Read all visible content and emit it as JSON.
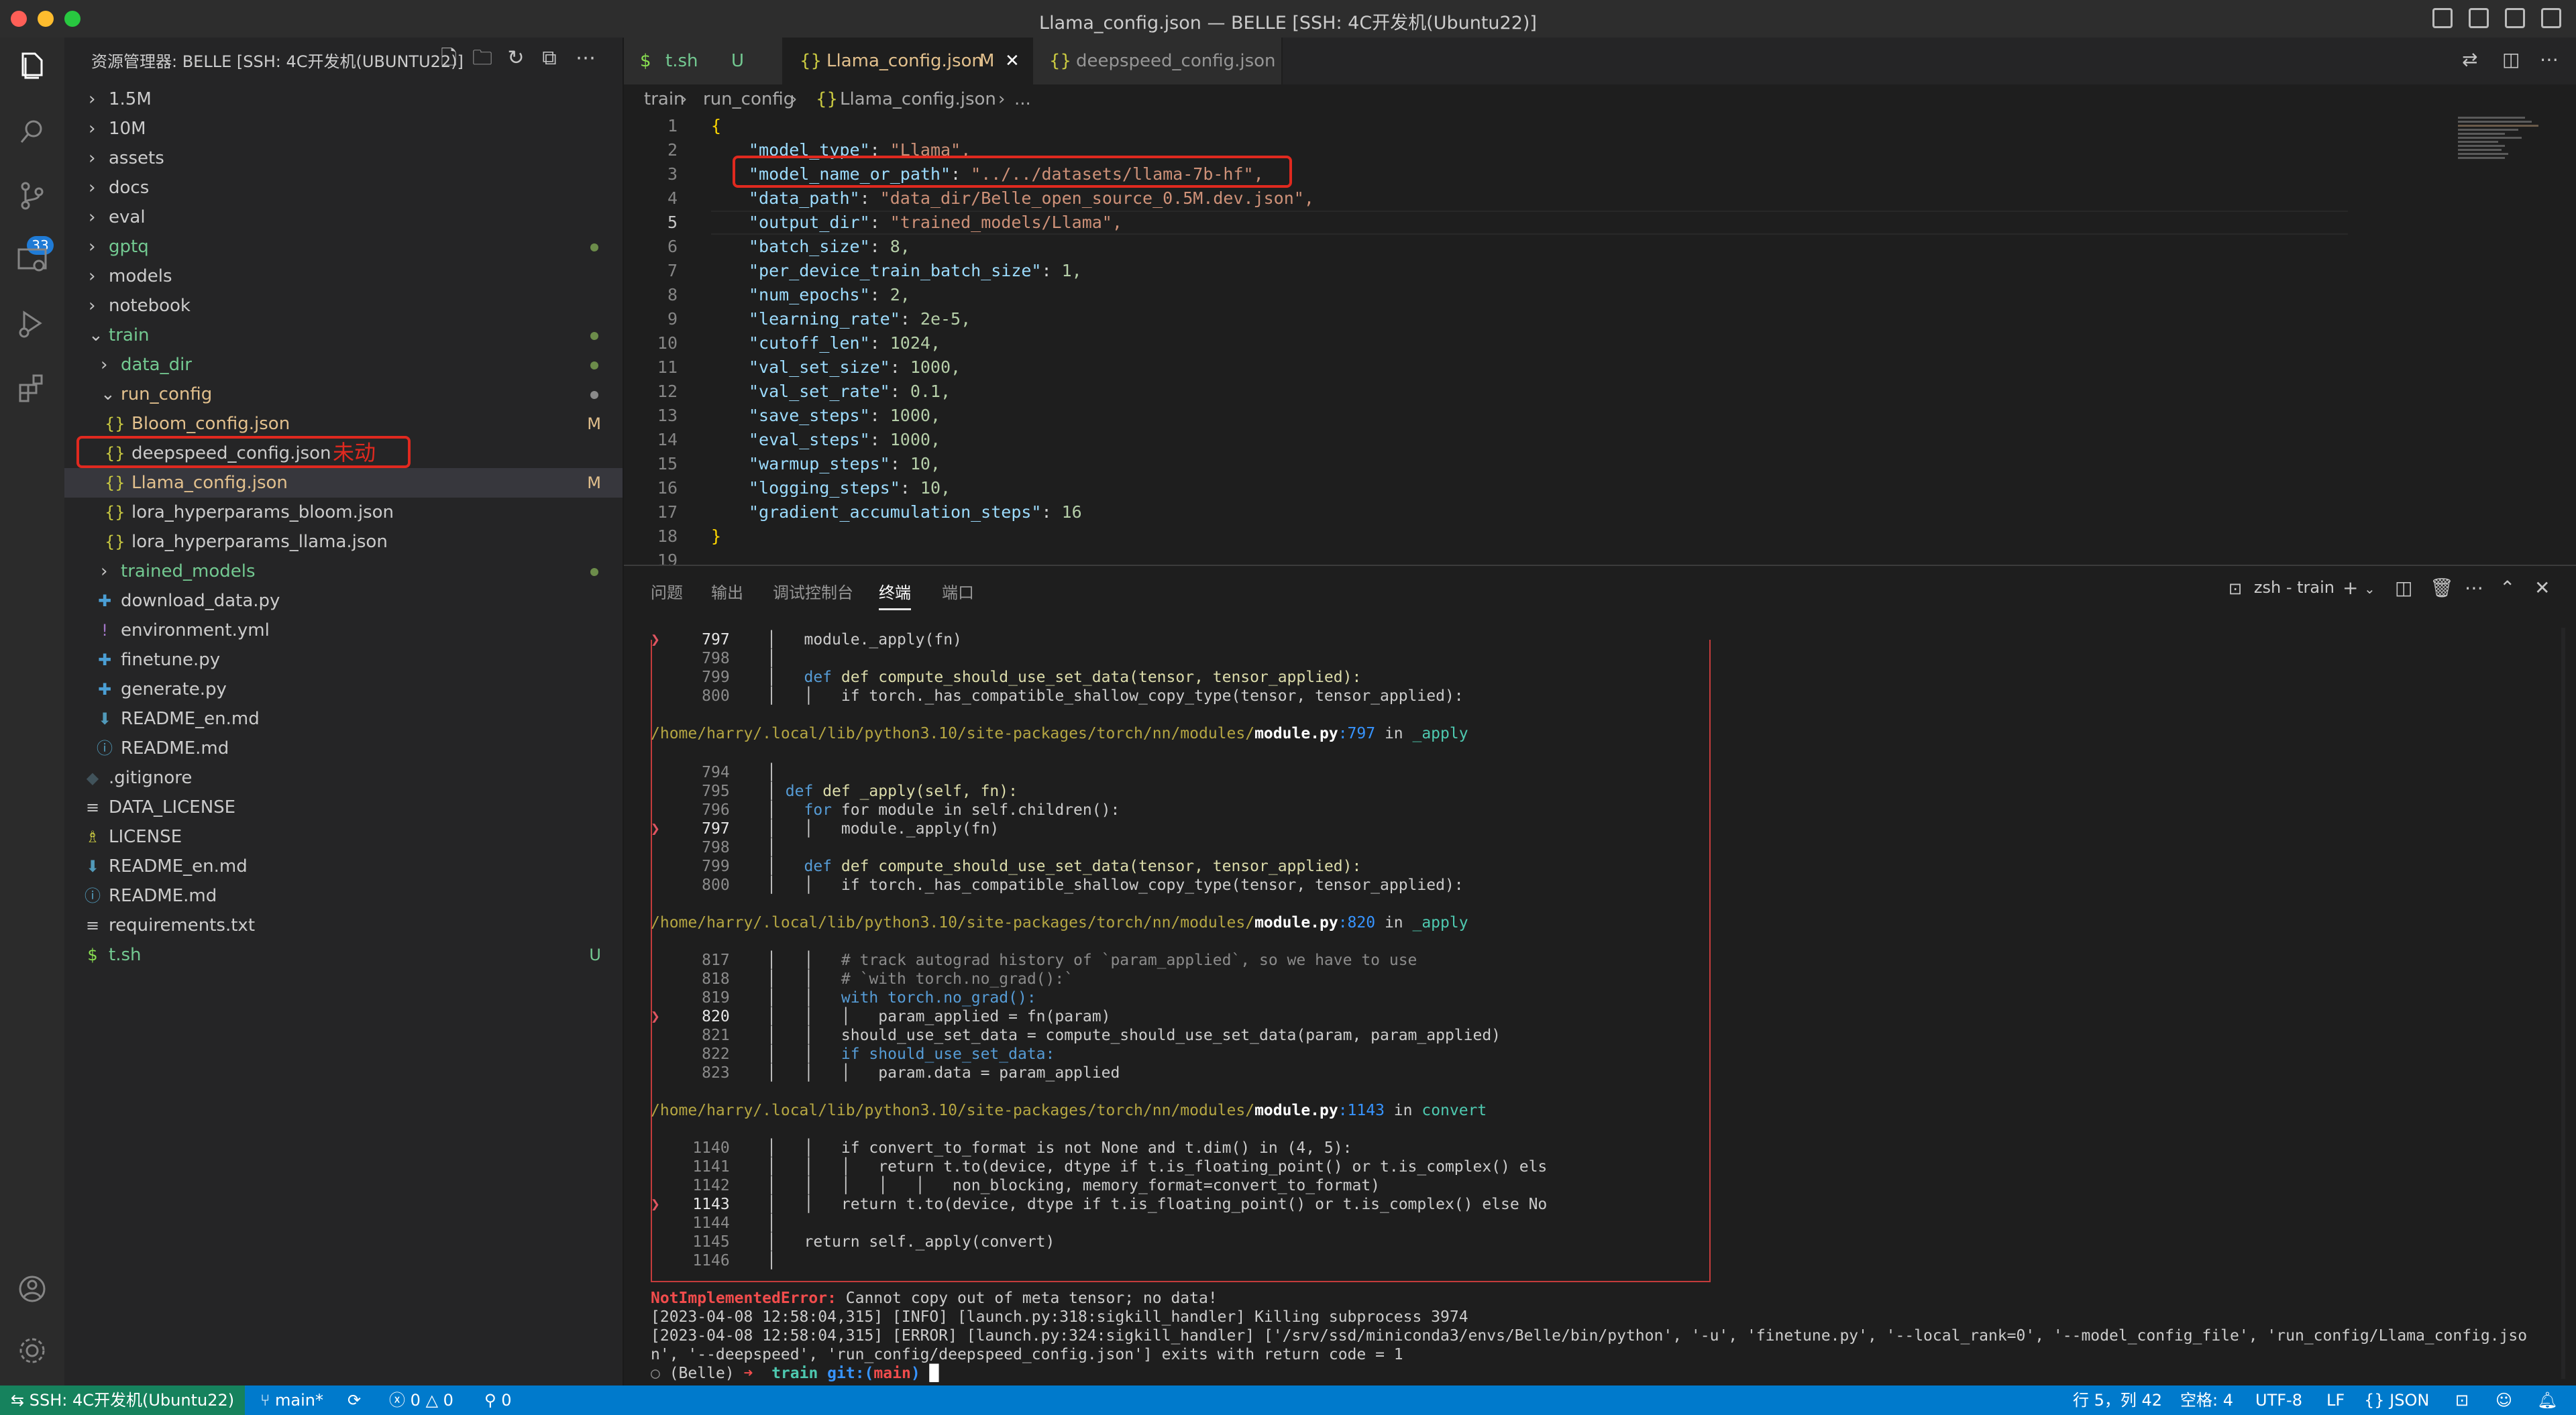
{
  "window": {
    "title": "Llama_config.json — BELLE [SSH: 4C开发机(Ubuntu22)]"
  },
  "activity": {
    "scm_badge": "33"
  },
  "explorer": {
    "header": "资源管理器: BELLE [SSH: 4C开发机(UBUNTU22)]",
    "annotation": "未动",
    "tree": [
      {
        "label": "1.5M",
        "status": ""
      },
      {
        "label": "10M",
        "status": ""
      },
      {
        "label": "assets",
        "status": ""
      },
      {
        "label": "docs",
        "status": ""
      },
      {
        "label": "eval",
        "status": ""
      },
      {
        "label": "gptq",
        "status": ""
      },
      {
        "label": "models",
        "status": ""
      },
      {
        "label": "notebook",
        "status": ""
      },
      {
        "label": "train",
        "status": ""
      },
      {
        "label": "data_dir",
        "status": ""
      },
      {
        "label": "run_config",
        "status": ""
      },
      {
        "label": "Bloom_config.json",
        "status": "M"
      },
      {
        "label": "deepspeed_config.json",
        "status": ""
      },
      {
        "label": "Llama_config.json",
        "status": "M"
      },
      {
        "label": "lora_hyperparams_bloom.json",
        "status": ""
      },
      {
        "label": "lora_hyperparams_llama.json",
        "status": ""
      },
      {
        "label": "trained_models",
        "status": ""
      },
      {
        "label": "download_data.py",
        "status": ""
      },
      {
        "label": "environment.yml",
        "status": ""
      },
      {
        "label": "finetune.py",
        "status": ""
      },
      {
        "label": "generate.py",
        "status": ""
      },
      {
        "label": "README_en.md",
        "status": ""
      },
      {
        "label": "README.md",
        "status": ""
      },
      {
        "label": ".gitignore",
        "status": ""
      },
      {
        "label": "DATA_LICENSE",
        "status": ""
      },
      {
        "label": "LICENSE",
        "status": ""
      },
      {
        "label": "README_en.md",
        "status": ""
      },
      {
        "label": "README.md",
        "status": ""
      },
      {
        "label": "requirements.txt",
        "status": ""
      },
      {
        "label": "t.sh",
        "status": "U"
      }
    ]
  },
  "tabs": [
    {
      "label": "t.sh",
      "mark": "U"
    },
    {
      "label": "Llama_config.json",
      "mark": "M"
    },
    {
      "label": "deepspeed_config.json",
      "mark": ""
    }
  ],
  "breadcrumb": [
    "train",
    "run_config",
    "Llama_config.json",
    "..."
  ],
  "code": {
    "line_numbers": [
      "1",
      "2",
      "3",
      "4",
      "5",
      "6",
      "7",
      "8",
      "9",
      "10",
      "11",
      "12",
      "13",
      "14",
      "15",
      "16",
      "17",
      "18",
      "19"
    ],
    "lines": [
      {
        "k": "",
        "v": "{"
      },
      {
        "k": "\"model_type\"",
        "v": "\"Llama\","
      },
      {
        "k": "\"model_name_or_path\"",
        "v": "\"../../datasets/llama-7b-hf\","
      },
      {
        "k": "\"data_path\"",
        "v": "\"data_dir/Belle_open_source_0.5M.dev.json\","
      },
      {
        "k": "\"output_dir\"",
        "v": "\"trained_models/Llama\","
      },
      {
        "k": "\"batch_size\"",
        "v": "8,"
      },
      {
        "k": "\"per_device_train_batch_size\"",
        "v": "1,"
      },
      {
        "k": "\"num_epochs\"",
        "v": "2,"
      },
      {
        "k": "\"learning_rate\"",
        "v": "2e-5,"
      },
      {
        "k": "\"cutoff_len\"",
        "v": "1024,"
      },
      {
        "k": "\"val_set_size\"",
        "v": "1000,"
      },
      {
        "k": "\"val_set_rate\"",
        "v": "0.1,"
      },
      {
        "k": "\"save_steps\"",
        "v": "1000,"
      },
      {
        "k": "\"eval_steps\"",
        "v": "1000,"
      },
      {
        "k": "\"warmup_steps\"",
        "v": "10,"
      },
      {
        "k": "\"logging_steps\"",
        "v": "10,"
      },
      {
        "k": "\"gradient_accumulation_steps\"",
        "v": "16"
      },
      {
        "k": "",
        "v": "}"
      },
      {
        "k": "",
        "v": ""
      }
    ]
  },
  "panel": {
    "tabs": [
      "问题",
      "输出",
      "调试控制台",
      "终端",
      "端口"
    ],
    "terminal_name": "zsh - train",
    "trace": {
      "b1_797": "module._apply(fn)",
      "b1_799": "def compute_should_use_set_data(tensor, tensor_applied):",
      "b1_800": "if torch._has_compatible_shallow_copy_type(tensor, tensor_applied):",
      "path_dir": "/home/harry/.local/lib/python3.10/site-packages/torch/nn/modules/",
      "path_file": "module.py",
      "p1_line": ":797",
      "p2_line": ":820",
      "p3_line": ":1143",
      "in": " in ",
      "fn_apply": "_apply",
      "fn_convert": "convert",
      "b2_795": "def _apply(self, fn):",
      "b2_796": "for module in self.children():",
      "b3_817": "# track autograd history of `param_applied`, so we have to use",
      "b3_818": "# `with torch.no_grad():`",
      "b3_819": "with torch.no_grad():",
      "b3_820": "param_applied = fn(param)",
      "b3_821": "should_use_set_data = compute_should_use_set_data(param, param_applied)",
      "b3_822": "if should_use_set_data:",
      "b3_823": "param.data = param_applied",
      "b4_1140": "if convert_to_format is not None and t.dim() in (4, 5):",
      "b4_1141": "return t.to(device, dtype if t.is_floating_point() or t.is_complex() els",
      "b4_1142": "non_blocking, memory_format=convert_to_format)",
      "b4_1143": "return t.to(device, dtype if t.is_floating_point() or t.is_complex() else No",
      "b4_1145": "return self._apply(convert)"
    },
    "error_name": "NotImplementedError:",
    "error_msg": " Cannot copy out of meta tensor; no data!",
    "log1": "[2023-04-08 12:58:04,315] [INFO] [launch.py:318:sigkill_handler] Killing subprocess 3974",
    "log2": "[2023-04-08 12:58:04,315] [ERROR] [launch.py:324:sigkill_handler] ['/srv/ssd/miniconda3/envs/Belle/bin/python', '-u', 'finetune.py', '--local_rank=0', '--model_config_file', 'run_config/Llama_config.jso",
    "log3": "n', '--deepspeed', 'run_config/deepspeed_config.json'] exits with return code = 1",
    "prompt_env": "(Belle)",
    "prompt_arrow": "➜",
    "prompt_dir": "train",
    "prompt_git": "git:(",
    "prompt_branch": "main",
    "prompt_git_close": ")"
  },
  "statusbar": {
    "remote": "SSH: 4C开发机(Ubuntu22)",
    "branch": "main*",
    "errors": "0",
    "warnings": "0",
    "ports": "0",
    "cursor": "行 5，列 42",
    "spaces": "空格: 4",
    "encoding": "UTF-8",
    "eol": "LF",
    "language": "JSON"
  }
}
